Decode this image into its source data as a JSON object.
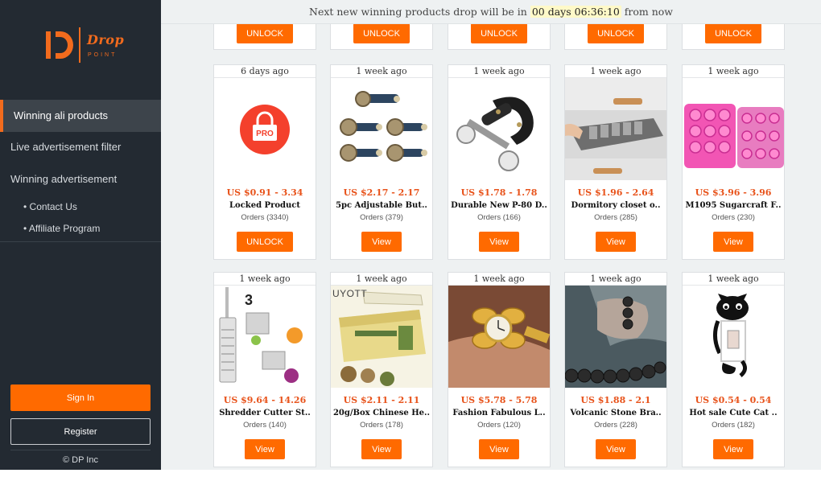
{
  "banner": {
    "prefix": "Next new winning products drop will be in",
    "timer": "00 days 06:36:10",
    "suffix": "from now"
  },
  "logo": {
    "word": "Drop",
    "sub": "POINT"
  },
  "sidebar": {
    "items": [
      {
        "label": "Winning ali products",
        "active": true
      },
      {
        "label": "Live advertisement filter"
      },
      {
        "label": "Winning advertisement"
      }
    ],
    "subitems": [
      {
        "label": "• Contact Us"
      },
      {
        "label": "• Affiliate Program"
      }
    ],
    "signin": "Sign In",
    "register": "Register",
    "copyright": "© DP Inc"
  },
  "top_row": [
    "UNLOCK",
    "UNLOCK",
    "UNLOCK",
    "UNLOCK",
    "UNLOCK"
  ],
  "rows": [
    [
      {
        "age": "6 days ago",
        "price": "US $0.91 - 3.34",
        "title": "Locked Product",
        "orders": "Orders (3340)",
        "button": "UNLOCK",
        "image": "pro-lock-icon"
      },
      {
        "age": "1 week ago",
        "price": "US $2.17 - 2.17",
        "title": "5pc Adjustable But..",
        "orders": "Orders (379)",
        "button": "View",
        "image": "button-extenders"
      },
      {
        "age": "1 week ago",
        "price": "US $1.78 - 1.78",
        "title": "Durable New P-80 D..",
        "orders": "Orders (166)",
        "button": "View",
        "image": "strap-tool"
      },
      {
        "age": "1 week ago",
        "price": "US $1.96 - 2.64",
        "title": "Dormitory closet o..",
        "orders": "Orders (285)",
        "button": "View",
        "image": "drawer-organizer"
      },
      {
        "age": "1 week ago",
        "price": "US $3.96 - 3.96",
        "title": "M1095 Sugarcraft F..",
        "orders": "Orders (230)",
        "button": "View",
        "image": "silicone-mold"
      }
    ],
    [
      {
        "age": "1 week ago",
        "price": "US $9.64 - 14.26",
        "title": "Shredder Cutter St..",
        "orders": "Orders (140)",
        "button": "View",
        "image": "grater-blades"
      },
      {
        "age": "1 week ago",
        "price": "US $2.11 - 2.11",
        "title": "20g/Box Chinese He..",
        "orders": "Orders (178)",
        "button": "View",
        "image": "herbal-cream",
        "brand": "UYOTT"
      },
      {
        "age": "1 week ago",
        "price": "US $5.78 - 5.78",
        "title": "Fashion Fabulous L..",
        "orders": "Orders (120)",
        "button": "View",
        "image": "gold-watch"
      },
      {
        "age": "1 week ago",
        "price": "US $1.88 - 2.1",
        "title": "Volcanic Stone Bra..",
        "orders": "Orders (228)",
        "button": "View",
        "image": "stone-bracelet"
      },
      {
        "age": "1 week ago",
        "price": "US $0.54 - 0.54",
        "title": "Hot sale Cute Cat ..",
        "orders": "Orders (182)",
        "button": "View",
        "image": "cat-switch-sticker"
      }
    ]
  ],
  "colors": {
    "accent": "#ff6a00",
    "sidebar": "#232a32",
    "price": "#e8531b"
  }
}
